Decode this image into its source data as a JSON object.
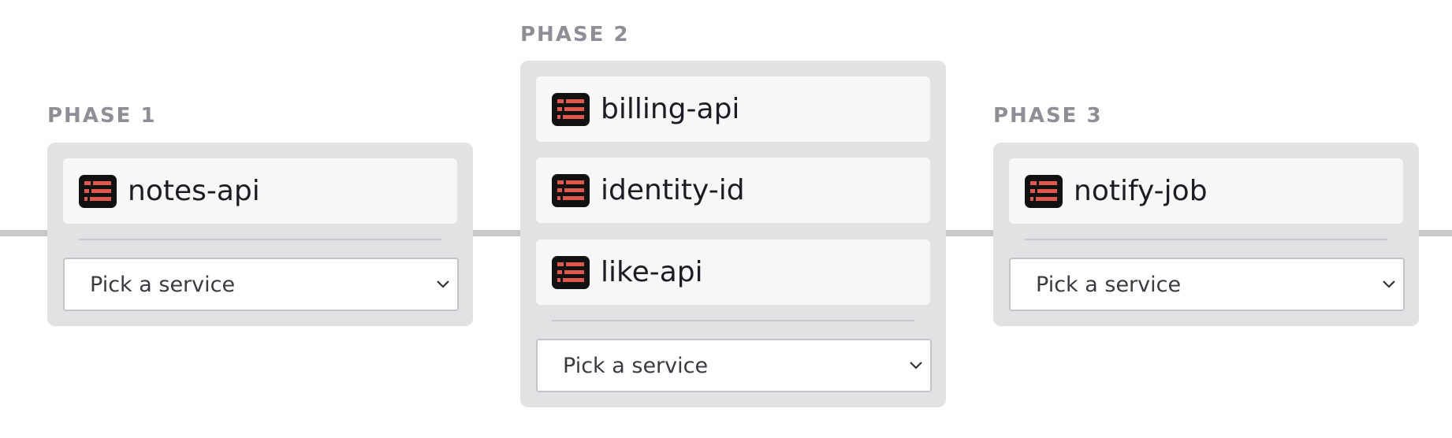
{
  "phases": [
    {
      "label": "PHASE 1",
      "services": [
        "notes-api"
      ],
      "picker_placeholder": "Pick a service"
    },
    {
      "label": "PHASE 2",
      "services": [
        "billing-api",
        "identity-id",
        "like-api"
      ],
      "picker_placeholder": "Pick a service"
    },
    {
      "label": "PHASE 3",
      "services": [
        "notify-job"
      ],
      "picker_placeholder": "Pick a service"
    }
  ],
  "icon": {
    "name": "service-icon",
    "color": "#e0574c",
    "background": "#111111"
  },
  "colors": {
    "phase_label": "#8e8e96",
    "phase_box": "#e2e2e5",
    "connector": "#c8c8cc"
  }
}
